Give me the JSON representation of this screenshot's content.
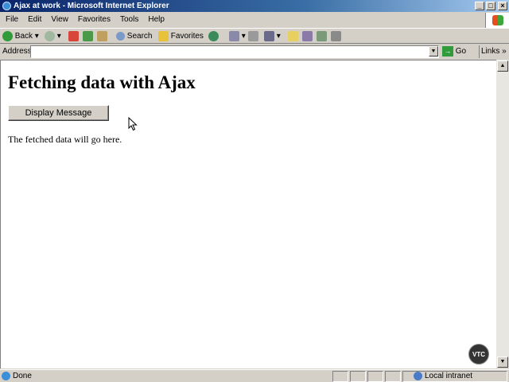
{
  "window": {
    "title": "Ajax at work - Microsoft Internet Explorer"
  },
  "menu": {
    "items": [
      "File",
      "Edit",
      "View",
      "Favorites",
      "Tools",
      "Help"
    ]
  },
  "toolbar": {
    "back_label": "Back",
    "search_label": "Search",
    "favorites_label": "Favorites"
  },
  "address": {
    "label": "Address",
    "value": "",
    "go_label": "Go",
    "links_label": "Links"
  },
  "page": {
    "heading": "Fetching data with Ajax",
    "button_label": "Display Message",
    "data_text": "The fetched data will go here."
  },
  "watermark": {
    "text": "VTC"
  },
  "status": {
    "text": "Done",
    "zone": "Local intranet"
  },
  "colors": {
    "titlebar": "#0a246a",
    "chrome": "#d4d0c8",
    "content": "#ffffff"
  }
}
